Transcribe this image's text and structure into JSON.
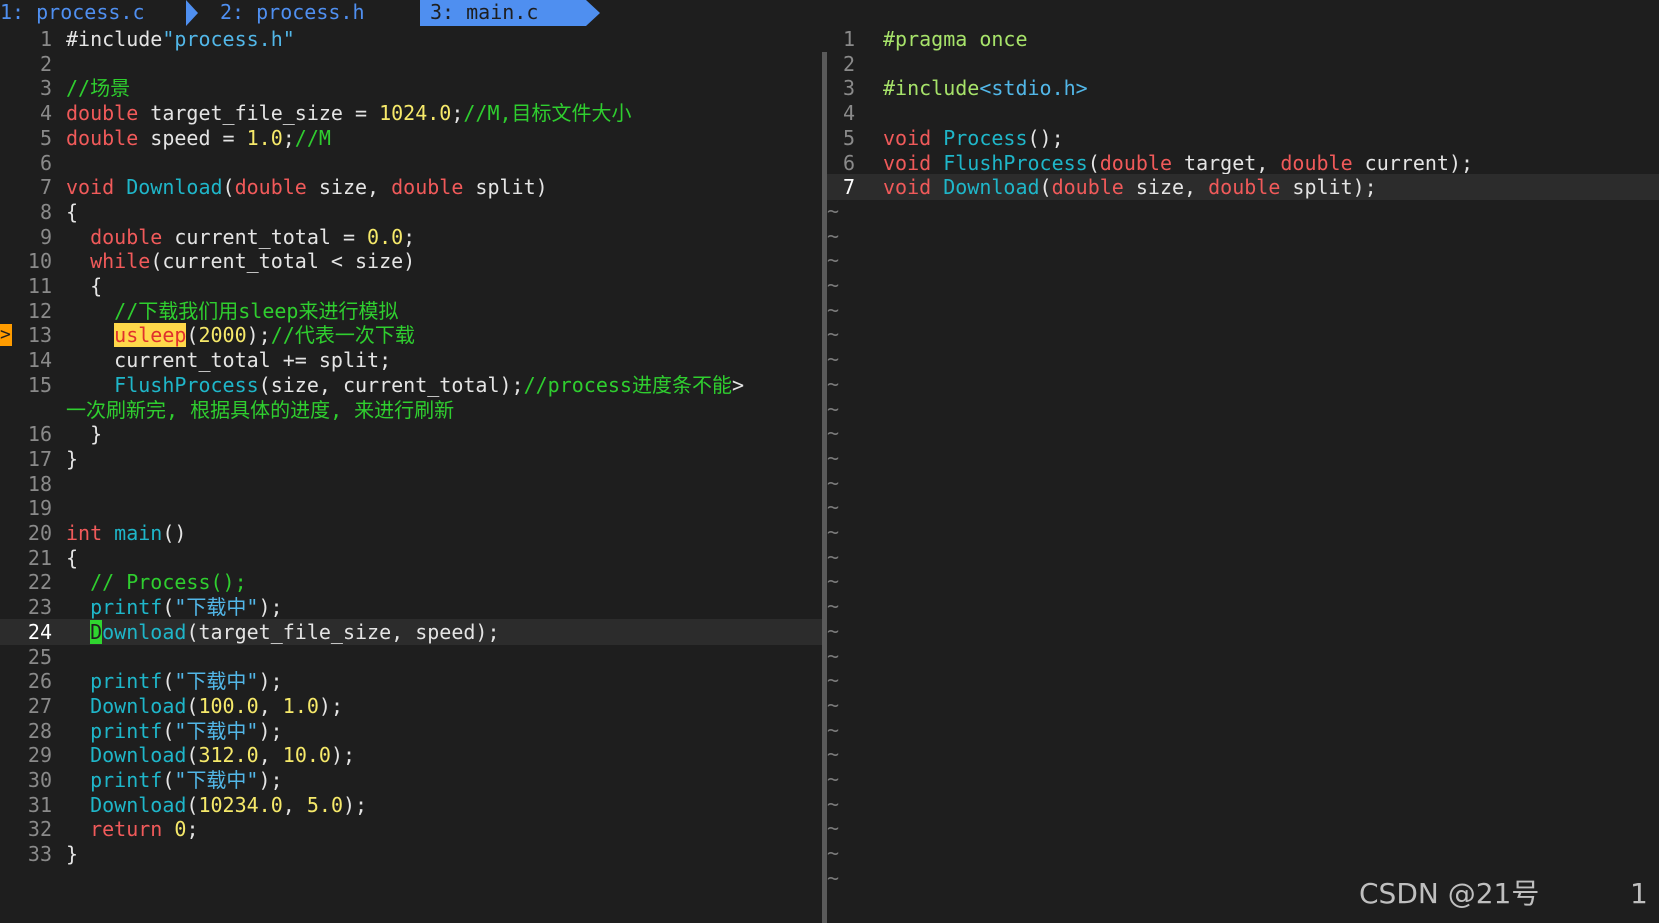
{
  "tabs": [
    {
      "label": "1: process.c"
    },
    {
      "label": "2: process.h"
    },
    {
      "label": "3: main.c"
    }
  ],
  "left": {
    "lines": [
      {
        "n": "1"
      },
      {
        "n": "2"
      },
      {
        "n": "3"
      },
      {
        "n": "4"
      },
      {
        "n": "5"
      },
      {
        "n": "6"
      },
      {
        "n": "7"
      },
      {
        "n": "8"
      },
      {
        "n": "9"
      },
      {
        "n": "10"
      },
      {
        "n": "11"
      },
      {
        "n": "12"
      },
      {
        "n": "13"
      },
      {
        "n": "14"
      },
      {
        "n": "15"
      },
      {
        "n": ""
      },
      {
        "n": "16"
      },
      {
        "n": "17"
      },
      {
        "n": "18"
      },
      {
        "n": "19"
      },
      {
        "n": "20"
      },
      {
        "n": "21"
      },
      {
        "n": "22"
      },
      {
        "n": "23"
      },
      {
        "n": "24"
      },
      {
        "n": "25"
      },
      {
        "n": "26"
      },
      {
        "n": "27"
      },
      {
        "n": "28"
      },
      {
        "n": "29"
      },
      {
        "n": "30"
      },
      {
        "n": "31"
      },
      {
        "n": "32"
      },
      {
        "n": "33"
      }
    ],
    "code": {
      "l1a": "#include",
      "l1b": "\"process.h\"",
      "l3": "//场景",
      "l4a": "double",
      "l4b": " target_file_size = ",
      "l4c": "1024.0",
      "l4d": ";",
      "l4e": "//M,目标文件大小",
      "l5a": "double",
      "l5b": " speed = ",
      "l5c": "1.0",
      "l5d": ";",
      "l5e": "//M",
      "l7a": "void",
      "l7b": "Download",
      "l7c": "(",
      "l7d": "double",
      "l7e": " size, ",
      "l7f": "double",
      "l7g": " split)",
      "l8": "{",
      "l9a": "double",
      "l9b": " current_total = ",
      "l9c": "0.0",
      "l9d": ";",
      "l10a": "while",
      "l10b": "(current_total < size)",
      "l11": "{",
      "l12": "//下载我们用sleep来进行模拟",
      "l13a": "usleep",
      "l13b": "(",
      "l13c": "2000",
      "l13d": ");",
      "l13e": "//代表一次下载",
      "l14": "current_total += split;",
      "l15a": "FlushProcess",
      "l15b": "(size, current_total);",
      "l15c": "//process进度条不能",
      "l15d": ">",
      "l15w": "一次刷新完, 根据具体的进度, 来进行刷新",
      "l16": "}",
      "l17": "}",
      "l20a": "int",
      "l20b": "main",
      "l20c": "()",
      "l21": "{",
      "l22": "// Process();",
      "l23a": "printf",
      "l23b": "(",
      "l23c": "\"下载中\"",
      "l23d": ");",
      "l24a": "D",
      "l24b": "ownload",
      "l24c": "(target_file_size, speed);",
      "l26a": "printf",
      "l26b": "(",
      "l26c": "\"下载中\"",
      "l26d": ");",
      "l27a": "Download",
      "l27b": "(",
      "l27c": "100.0",
      "l27d": ", ",
      "l27e": "1.0",
      "l27f": ");",
      "l28a": "printf",
      "l28b": "(",
      "l28c": "\"下载中\"",
      "l28d": ");",
      "l29a": "Download",
      "l29b": "(",
      "l29c": "312.0",
      "l29d": ", ",
      "l29e": "10.0",
      "l29f": ");",
      "l30a": "printf",
      "l30b": "(",
      "l30c": "\"下载中\"",
      "l30d": ");",
      "l31a": "Download",
      "l31b": "(",
      "l31c": "10234.0",
      "l31d": ", ",
      "l31e": "5.0",
      "l31f": ");",
      "l32a": "return",
      "l32b": "0",
      "l32c": ";",
      "l33": "}"
    },
    "sign_marker": ">"
  },
  "right": {
    "lines": [
      {
        "n": "1"
      },
      {
        "n": "2"
      },
      {
        "n": "3"
      },
      {
        "n": "4"
      },
      {
        "n": "5"
      },
      {
        "n": "6"
      },
      {
        "n": "7"
      }
    ],
    "code": {
      "r1": "#pragma once",
      "r3a": "#include",
      "r3b": "<stdio.h>",
      "r5a": "void",
      "r5b": "Process",
      "r5c": "();",
      "r6a": "void",
      "r6b": "FlushProcess",
      "r6c": "(",
      "r6d": "double",
      "r6e": " target, ",
      "r6f": "double",
      "r6g": " current);",
      "r7a": "void",
      "r7b": "Download",
      "r7c": "(",
      "r7d": "double",
      "r7e": " size, ",
      "r7f": "double",
      "r7g": " split);"
    },
    "tilde": "~"
  },
  "watermark": {
    "text": "CSDN @21号",
    "number": "1"
  },
  "colors": {
    "background": "#1e1e1e",
    "tab_accent": "#4f8ff0",
    "keyword": "#f05a5a",
    "function": "#1fb6c9",
    "number": "#f6e96a",
    "comment": "#2fce2f",
    "string": "#52b7e8"
  }
}
